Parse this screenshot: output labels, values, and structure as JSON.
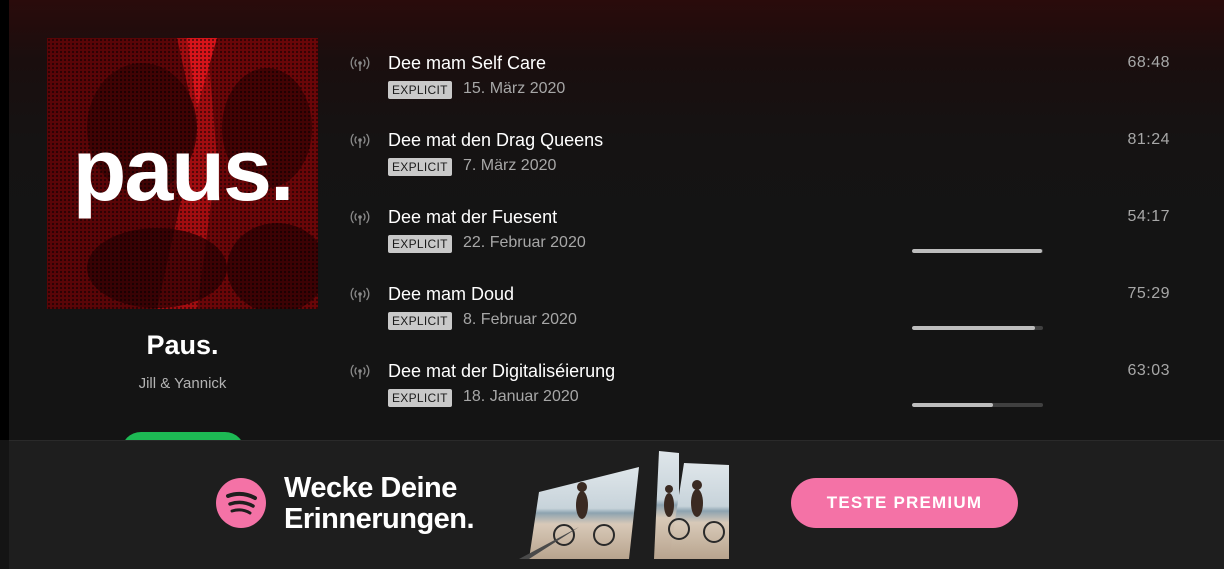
{
  "colors": {
    "accent_green": "#1db954",
    "premium_pink": "#f472a6",
    "cover_red": "#8e0b0e",
    "badge_bg": "#c9c9c9"
  },
  "show": {
    "cover_text": "paus.",
    "title": "Paus.",
    "author": "Jill & Yannick",
    "play_button_icon": "play-button"
  },
  "episodes": [
    {
      "icon": "podcast-broadcast-icon",
      "title": "Dee mam Self Care",
      "badge": "EXPLICIT",
      "date": "15. März 2020",
      "duration": "68:48",
      "progress": null
    },
    {
      "icon": "podcast-broadcast-icon",
      "title": "Dee mat den Drag Queens",
      "badge": "EXPLICIT",
      "date": "7. März 2020",
      "duration": "81:24",
      "progress": null
    },
    {
      "icon": "podcast-broadcast-icon",
      "title": "Dee mat der Fuesent",
      "badge": "EXPLICIT",
      "date": "22. Februar 2020",
      "duration": "54:17",
      "progress": 0.99
    },
    {
      "icon": "podcast-broadcast-icon",
      "title": "Dee mam Doud",
      "badge": "EXPLICIT",
      "date": "8. Februar 2020",
      "duration": "75:29",
      "progress": 0.94
    },
    {
      "icon": "podcast-broadcast-icon",
      "title": "Dee mat der Digitaliséierung",
      "badge": "EXPLICIT",
      "date": "18. Januar 2020",
      "duration": "63:03",
      "progress": 0.62
    }
  ],
  "ad": {
    "logo_icon": "spotify-logo-icon",
    "headline_line1": "Wecke Deine",
    "headline_line2": "Erinnerungen.",
    "cta_label": "TESTE PREMIUM"
  }
}
